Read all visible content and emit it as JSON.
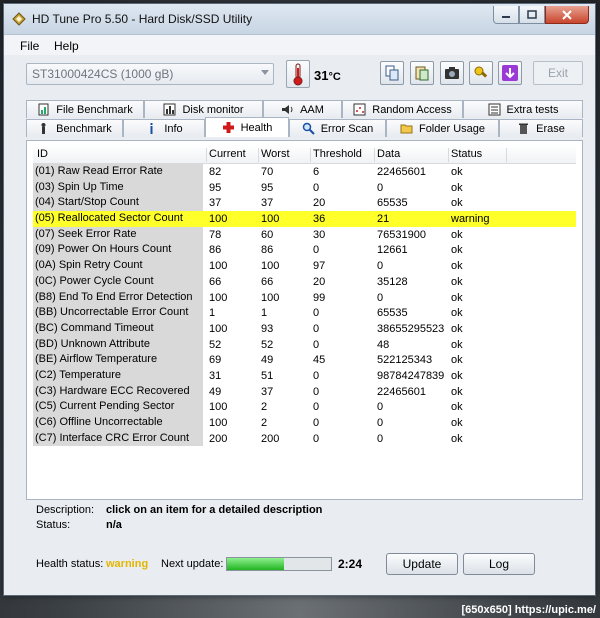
{
  "window": {
    "title": "HD Tune Pro 5.50 - Hard Disk/SSD Utility"
  },
  "menu": {
    "file": "File",
    "help": "Help"
  },
  "toolbar": {
    "drive": "ST31000424CS (1000 gB)",
    "temperature": "31",
    "temperature_unit": "°C",
    "exit_label": "Exit"
  },
  "tabs_top": [
    {
      "label": "File Benchmark",
      "icon": "file-benchmark-icon"
    },
    {
      "label": "Disk monitor",
      "icon": "disk-monitor-icon"
    },
    {
      "label": "AAM",
      "icon": "speaker-icon"
    },
    {
      "label": "Random Access",
      "icon": "random-access-icon"
    },
    {
      "label": "Extra tests",
      "icon": "extra-tests-icon"
    }
  ],
  "tabs_bottom": [
    {
      "label": "Benchmark",
      "icon": "benchmark-icon"
    },
    {
      "label": "Info",
      "icon": "info-icon"
    },
    {
      "label": "Health",
      "icon": "health-cross-icon"
    },
    {
      "label": "Error Scan",
      "icon": "magnifier-icon"
    },
    {
      "label": "Folder Usage",
      "icon": "folder-icon"
    },
    {
      "label": "Erase",
      "icon": "trash-icon"
    }
  ],
  "table": {
    "headers": [
      "ID",
      "Current",
      "Worst",
      "Threshold",
      "Data",
      "Status"
    ],
    "rows": [
      [
        "(01) Raw Read Error Rate",
        "82",
        "70",
        "6",
        "22465601",
        "ok"
      ],
      [
        "(03) Spin Up Time",
        "95",
        "95",
        "0",
        "0",
        "ok"
      ],
      [
        "(04) Start/Stop Count",
        "37",
        "37",
        "20",
        "65535",
        "ok"
      ],
      [
        "(05) Reallocated Sector Count",
        "100",
        "100",
        "36",
        "21",
        "warning"
      ],
      [
        "(07) Seek Error Rate",
        "78",
        "60",
        "30",
        "76531900",
        "ok"
      ],
      [
        "(09) Power On Hours Count",
        "86",
        "86",
        "0",
        "12661",
        "ok"
      ],
      [
        "(0A) Spin Retry Count",
        "100",
        "100",
        "97",
        "0",
        "ok"
      ],
      [
        "(0C) Power Cycle Count",
        "66",
        "66",
        "20",
        "35128",
        "ok"
      ],
      [
        "(B8) End To End Error Detection",
        "100",
        "100",
        "99",
        "0",
        "ok"
      ],
      [
        "(BB) Uncorrectable Error Count",
        "1",
        "1",
        "0",
        "65535",
        "ok"
      ],
      [
        "(BC) Command Timeout",
        "100",
        "93",
        "0",
        "38655295523",
        "ok"
      ],
      [
        "(BD) Unknown Attribute",
        "52",
        "52",
        "0",
        "48",
        "ok"
      ],
      [
        "(BE) Airflow Temperature",
        "69",
        "49",
        "45",
        "522125343",
        "ok"
      ],
      [
        "(C2) Temperature",
        "31",
        "51",
        "0",
        "98784247839",
        "ok"
      ],
      [
        "(C3) Hardware ECC Recovered",
        "49",
        "37",
        "0",
        "22465601",
        "ok"
      ],
      [
        "(C5) Current Pending Sector",
        "100",
        "2",
        "0",
        "0",
        "ok"
      ],
      [
        "(C6) Offline Uncorrectable",
        "100",
        "2",
        "0",
        "0",
        "ok"
      ],
      [
        "(C7) Interface CRC Error Count",
        "200",
        "200",
        "0",
        "0",
        "ok"
      ]
    ],
    "highlight_row": 3,
    "highlight_color": "#ffff2a"
  },
  "description": {
    "label": "Description:",
    "value": "click on an item for a detailed description",
    "status_label": "Status:",
    "status_value": "n/a"
  },
  "footer": {
    "health_label": "Health status:",
    "health_value": "warning",
    "health_color": "#e2b600",
    "next_update_label": "Next update:",
    "progress": 0.55,
    "countdown": "2:24",
    "update_label": "Update",
    "log_label": "Log"
  },
  "watermark": "[650x650] https://upic.me/"
}
